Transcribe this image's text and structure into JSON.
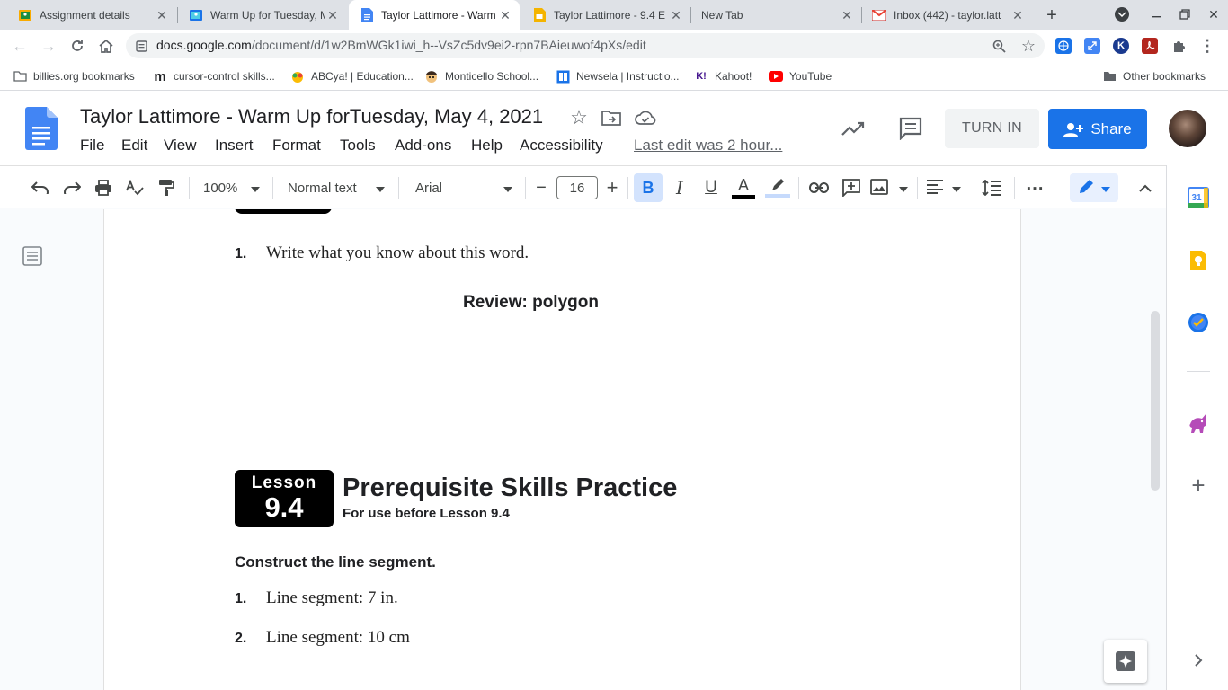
{
  "browser": {
    "tabs": [
      {
        "title": "Assignment details",
        "icon": "google-classroom-icon"
      },
      {
        "title": "Warm Up for Tuesday, M",
        "icon": "google-classroom-icon"
      },
      {
        "title": "Taylor Lattimore - Warm",
        "icon": "google-docs-icon",
        "active": true
      },
      {
        "title": "Taylor Lattimore - 9.4 E",
        "icon": "google-slides-icon"
      },
      {
        "title": "New Tab",
        "icon": ""
      },
      {
        "title": "Inbox (442) - taylor.latt",
        "icon": "gmail-icon"
      }
    ],
    "url_domain": "docs.google.com",
    "url_path": "/document/d/1w2BmWGk1iwi_h--VsZc5dv9ei2-rpn7BAieuwof4pXs/edit",
    "bookmarks": [
      {
        "label": "billies.org bookmarks",
        "icon": "folder-icon"
      },
      {
        "label": "cursor-control skills...",
        "icon": "m-logo-icon"
      },
      {
        "label": "ABCya! | Education...",
        "icon": "abcya-icon"
      },
      {
        "label": "Monticello School...",
        "icon": "school-icon"
      },
      {
        "label": "Newsela | Instructio...",
        "icon": "newsela-icon"
      },
      {
        "label": "Kahoot!",
        "icon": "kahoot-icon"
      },
      {
        "label": "YouTube",
        "icon": "youtube-icon"
      }
    ],
    "other_bookmarks": "Other bookmarks"
  },
  "docs": {
    "title": "Taylor Lattimore - Warm Up forTuesday, May 4, 2021",
    "menu": [
      "File",
      "Edit",
      "View",
      "Insert",
      "Format",
      "Tools",
      "Add-ons",
      "Help",
      "Accessibility"
    ],
    "last_edit": "Last edit was 2 hour...",
    "turn_in": "TURN IN",
    "share": "Share",
    "accent": "#1a73e8"
  },
  "toolbar": {
    "zoom": "100%",
    "style": "Normal text",
    "font": "Arial",
    "font_size": "16",
    "minus": "−",
    "plus": "+"
  },
  "document": {
    "item1_num": "1.",
    "item1_text": "Write what you know about this word.",
    "review": "Review: polygon",
    "lesson_label": "Lesson",
    "lesson_num": "9.4",
    "heading": "Prerequisite Skills Practice",
    "subheading": "For use before Lesson 9.4",
    "instruction": "Construct the line segment.",
    "items": [
      {
        "num": "1.",
        "text": "Line segment: 7 in."
      },
      {
        "num": "2.",
        "text": "Line segment: 10 cm"
      }
    ]
  }
}
